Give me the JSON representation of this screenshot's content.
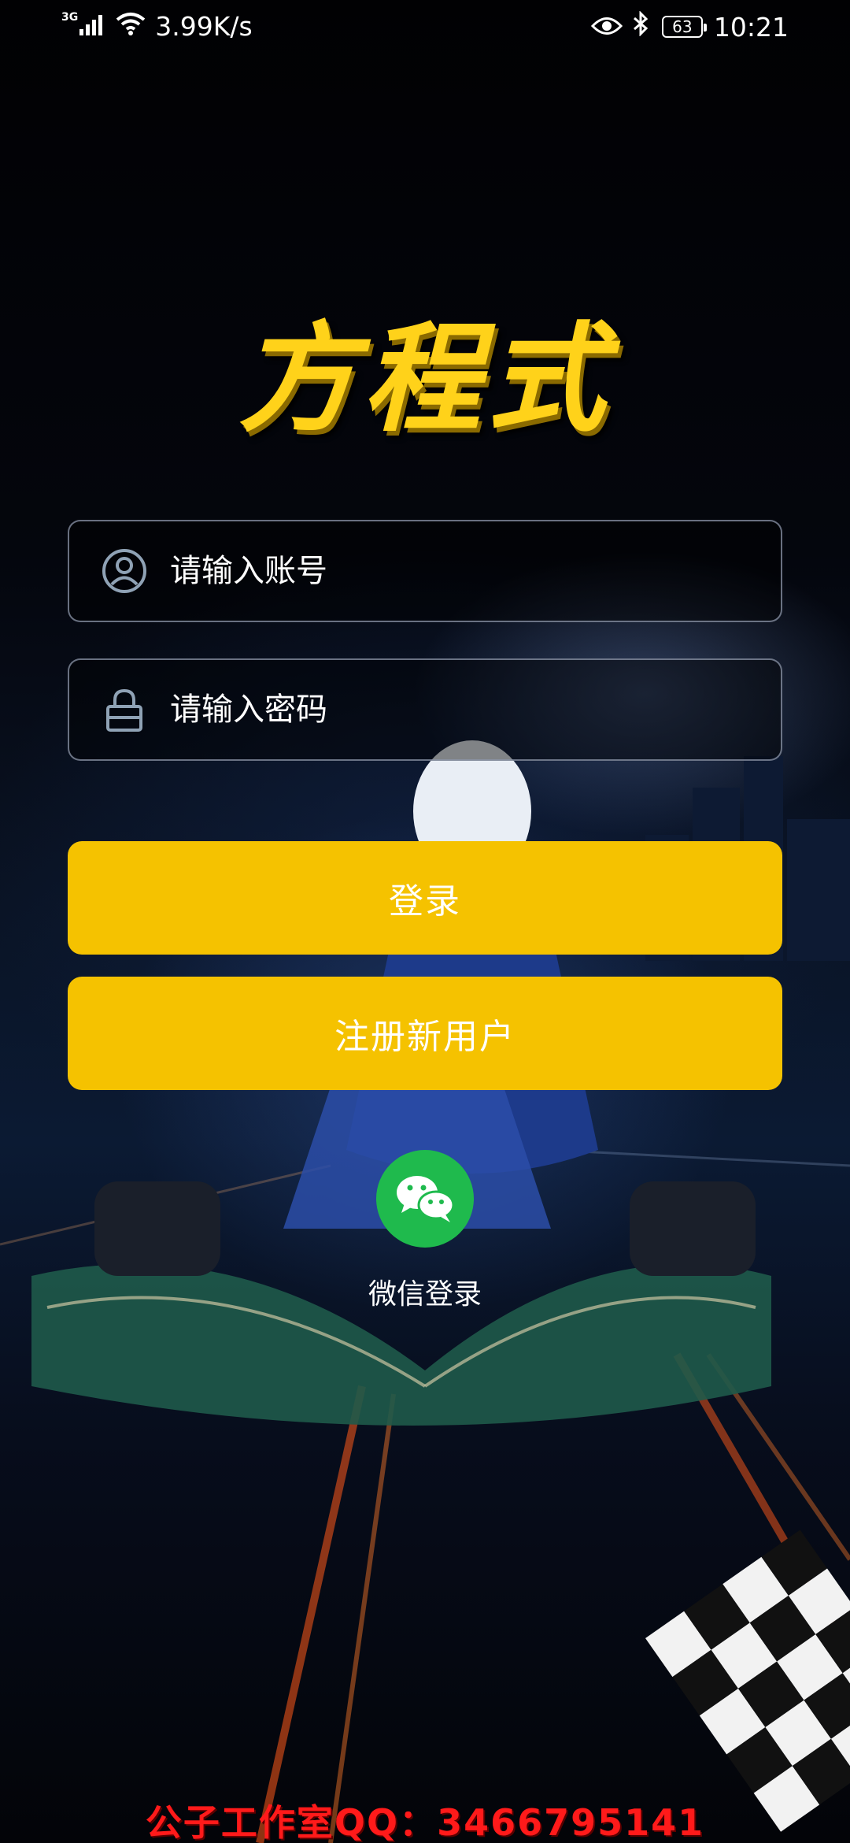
{
  "status_bar": {
    "network_type": "3G",
    "network_speed": "3.99K/s",
    "battery_level": "63",
    "time": "10:21",
    "icons": [
      "signal-icon",
      "wifi-icon",
      "eye-icon",
      "bluetooth-icon",
      "battery-icon"
    ]
  },
  "app": {
    "title": "方程式"
  },
  "login_form": {
    "account_placeholder": "请输入账号",
    "account_value": "",
    "password_placeholder": "请输入密码",
    "password_value": "",
    "login_label": "登录",
    "register_label": "注册新用户"
  },
  "wechat": {
    "label": "微信登录"
  },
  "footer": {
    "contact_text": "公子工作室QQ：3466795141"
  },
  "colors": {
    "button": "#f5c200",
    "title": "#ffd21a",
    "wechat": "#1fba4d",
    "contact": "#ff1a1a"
  }
}
